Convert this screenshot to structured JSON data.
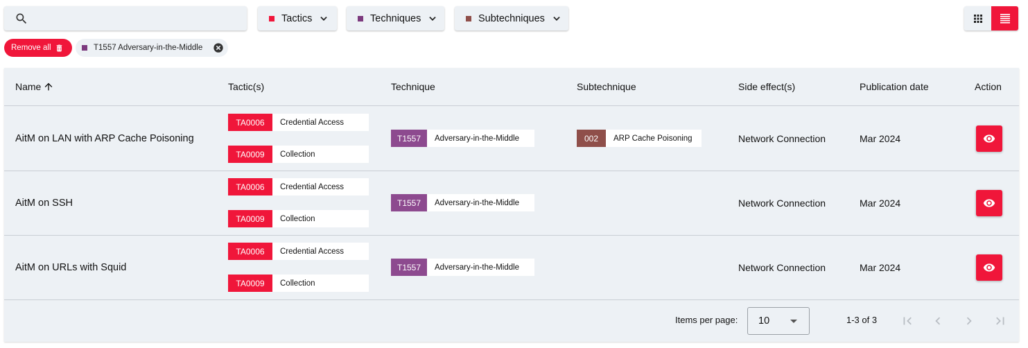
{
  "search": {
    "placeholder": "",
    "value": ""
  },
  "filters": {
    "tactics": {
      "label": "Tactics",
      "color": "#f0163a"
    },
    "techniques": {
      "label": "Techniques",
      "color": "#7c3a7e"
    },
    "subtechniques": {
      "label": "Subtechniques",
      "color": "#8f4f4a"
    }
  },
  "view_toggle": {
    "active": "list",
    "options": [
      "grid",
      "list"
    ]
  },
  "chips": {
    "remove_all": "Remove all",
    "active_filters": [
      {
        "label": "T1557 Adversary-in-the-Middle",
        "color": "#7c3a7e"
      }
    ]
  },
  "table": {
    "headers": {
      "name": "Name",
      "tactics": "Tactic(s)",
      "technique": "Technique",
      "subtechnique": "Subtechnique",
      "side_effects": "Side effect(s)",
      "publication_date": "Publication date",
      "action": "Action"
    },
    "sort": {
      "column": "name",
      "direction": "ascending"
    },
    "rows": [
      {
        "name": "AitM on LAN with ARP Cache Poisoning",
        "tactics": [
          {
            "id": "TA0006",
            "label": "Credential Access"
          },
          {
            "id": "TA0009",
            "label": "Collection"
          }
        ],
        "technique": {
          "id": "T1557",
          "label": "Adversary-in-the-Middle"
        },
        "subtechnique": {
          "id": "002",
          "label": "ARP Cache Poisoning"
        },
        "side_effect": "Network Connection",
        "publication_date": "Mar 2024"
      },
      {
        "name": "AitM on SSH",
        "tactics": [
          {
            "id": "TA0006",
            "label": "Credential Access"
          },
          {
            "id": "TA0009",
            "label": "Collection"
          }
        ],
        "technique": {
          "id": "T1557",
          "label": "Adversary-in-the-Middle"
        },
        "side_effect": "Network Connection",
        "publication_date": "Mar 2024"
      },
      {
        "name": "AitM on URLs with Squid",
        "tactics": [
          {
            "id": "TA0006",
            "label": "Credential Access"
          },
          {
            "id": "TA0009",
            "label": "Collection"
          }
        ],
        "technique": {
          "id": "T1557",
          "label": "Adversary-in-the-Middle"
        },
        "side_effect": "Network Connection",
        "publication_date": "Mar 2024"
      }
    ]
  },
  "paginator": {
    "items_per_page_label": "Items per page:",
    "items_per_page": "10",
    "range": "1-3 of 3"
  },
  "colors": {
    "accent": "#f0163a",
    "tactic": "#f0163a",
    "technique": "#8d4a8f",
    "subtechnique": "#8f4f4a",
    "panel": "#edf1f5"
  }
}
